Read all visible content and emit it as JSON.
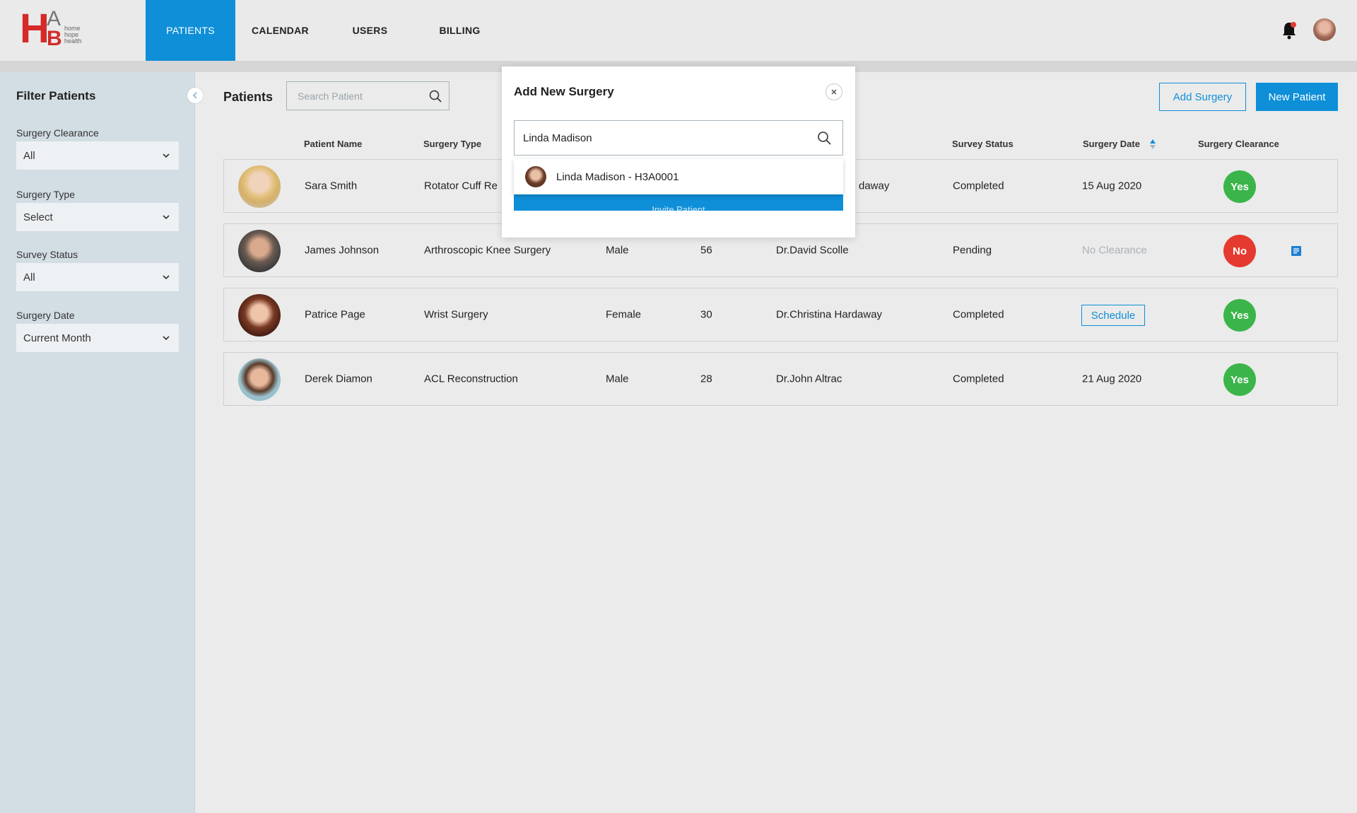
{
  "brand": {
    "logo_letters": "HAB",
    "logo_tagline": "home hope health"
  },
  "nav": {
    "items": [
      {
        "label": "PATIENTS",
        "active": true
      },
      {
        "label": "CALENDAR",
        "active": false
      },
      {
        "label": "USERS",
        "active": false
      },
      {
        "label": "BILLING",
        "active": false
      }
    ]
  },
  "header": {
    "notification_icon": "bell-icon",
    "avatar_icon": "user-avatar"
  },
  "sidebar": {
    "title": "Filter Patients",
    "filters": [
      {
        "label": "Surgery Clearance",
        "value": "All"
      },
      {
        "label": "Surgery Type",
        "value": "Select"
      },
      {
        "label": "Survey Status",
        "value": "All"
      },
      {
        "label": "Surgery Date",
        "value": "Current Month"
      }
    ]
  },
  "main": {
    "title": "Patients",
    "search_placeholder": "Search Patient",
    "add_surgery_label": "Add Surgery",
    "new_patient_label": "New Patient",
    "columns": {
      "patient_name": "Patient Name",
      "surgery_type": "Surgery Type",
      "survey_status": "Survey Status",
      "surgery_date": "Surgery Date",
      "surgery_clearance": "Surgery Clearance"
    },
    "rows": [
      {
        "name": "Sara Smith",
        "surgery": "Rotator Cuff Re",
        "gender": "",
        "age": "",
        "doctor": "daway",
        "survey": "Completed",
        "date": "15 Aug 2020",
        "clearance": "Yes"
      },
      {
        "name": "James Johnson",
        "surgery": "Arthroscopic Knee Surgery",
        "gender": "Male",
        "age": "56",
        "doctor": "Dr.David Scolle",
        "survey": "Pending",
        "date": "No Clearance",
        "clearance": "No"
      },
      {
        "name": "Patrice Page",
        "surgery": "Wrist Surgery",
        "gender": "Female",
        "age": "30",
        "doctor": "Dr.Christina Hardaway",
        "survey": "Completed",
        "date": "Schedule",
        "clearance": "Yes"
      },
      {
        "name": "Derek Diamon",
        "surgery": "ACL Reconstruction",
        "gender": "Male",
        "age": "28",
        "doctor": "Dr.John Altrac",
        "survey": "Completed",
        "date": "21 Aug 2020",
        "clearance": "Yes"
      }
    ]
  },
  "modal": {
    "title": "Add New Surgery",
    "close_icon": "close-icon",
    "search_value": "Linda Madison",
    "suggestion": "Linda Madison - H3A0001",
    "cta_label": "Invite Patient"
  },
  "colors": {
    "primary": "#0e8fd8",
    "success": "#3bb54a",
    "danger": "#e53a2f",
    "logo_red": "#d42a2a"
  }
}
